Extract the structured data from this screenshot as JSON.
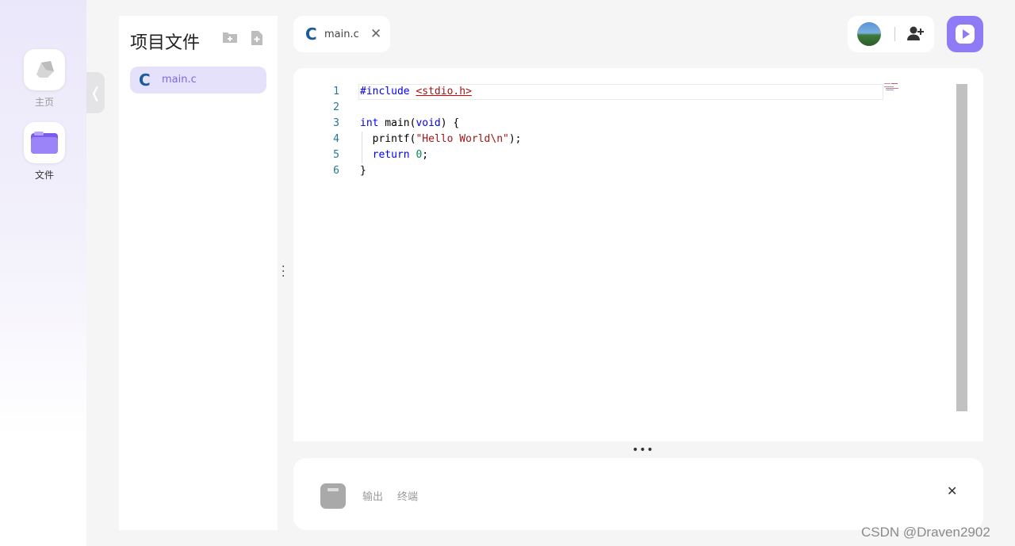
{
  "rail": {
    "items": [
      {
        "label": "主页",
        "icon": "home-icon"
      },
      {
        "label": "文件",
        "icon": "folder-icon"
      }
    ],
    "collapse_glyph": "❬"
  },
  "files": {
    "title": "项目文件",
    "items": [
      {
        "name": "main.c",
        "lang_letter": "C"
      }
    ]
  },
  "tab": {
    "name": "main.c",
    "lang_letter": "C",
    "close": "✕"
  },
  "editor": {
    "lines": [
      {
        "num": "1"
      },
      {
        "num": "2"
      },
      {
        "num": "3"
      },
      {
        "num": "4"
      },
      {
        "num": "5"
      },
      {
        "num": "6"
      }
    ],
    "code": {
      "l1_a": "#include ",
      "l1_b": "<stdio.h>",
      "l3_a": "int",
      "l3_b": " main(",
      "l3_c": "void",
      "l3_d": ") {",
      "l4_a": "  printf(",
      "l4_b": "\"Hello World\\n\"",
      "l4_c": ");",
      "l5_a": "  return",
      "l5_b": " ",
      "l5_c": "0",
      "l5_d": ";",
      "l6_a": "}"
    }
  },
  "output": {
    "tabs": [
      "输出",
      "终端"
    ],
    "close": "✕"
  },
  "watermark": "CSDN @Draven2902",
  "colors": {
    "accent": "#8e7bf5",
    "selected_bg": "#e6e1fb",
    "c_letter": "#1d5a99"
  }
}
